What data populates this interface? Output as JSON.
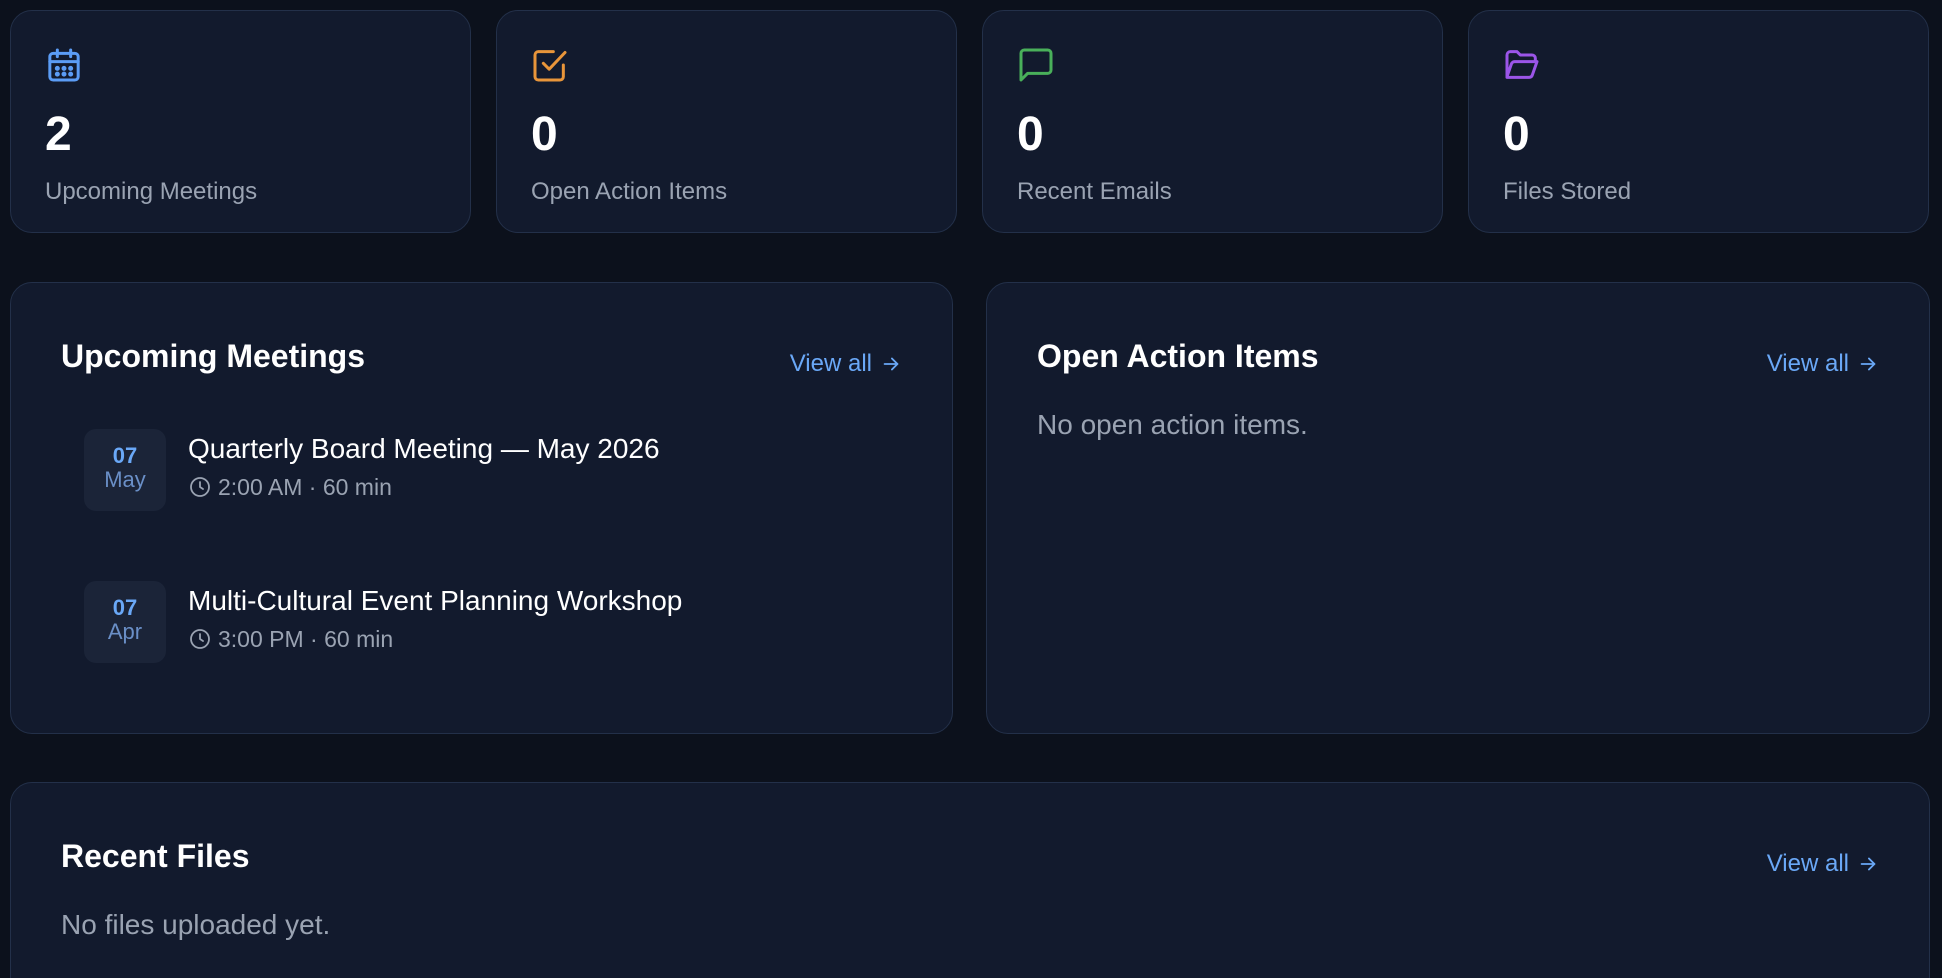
{
  "stats": [
    {
      "icon": "calendar-icon",
      "value": "2",
      "label": "Upcoming Meetings",
      "color": "#5b9cf5"
    },
    {
      "icon": "checkbox-icon",
      "value": "0",
      "label": "Open Action Items",
      "color": "#e8953a"
    },
    {
      "icon": "message-icon",
      "value": "0",
      "label": "Recent Emails",
      "color": "#49b05a"
    },
    {
      "icon": "folder-open-icon",
      "value": "0",
      "label": "Files Stored",
      "color": "#9b55e8"
    }
  ],
  "meetings_panel": {
    "title": "Upcoming Meetings",
    "view_all": "View all",
    "items": [
      {
        "day": "07",
        "month": "May",
        "title": "Quarterly Board Meeting — May 2026",
        "meta": "2:00 AM · 60 min"
      },
      {
        "day": "07",
        "month": "Apr",
        "title": "Multi-Cultural Event Planning Workshop",
        "meta": "3:00 PM · 60 min"
      }
    ]
  },
  "actions_panel": {
    "title": "Open Action Items",
    "view_all": "View all",
    "empty": "No open action items."
  },
  "files_panel": {
    "title": "Recent Files",
    "view_all": "View all",
    "empty": "No files uploaded yet."
  },
  "colors": {
    "background": "#0c111c",
    "card": "#121a2d",
    "border": "#233049",
    "accent": "#6aa8f7",
    "muted_text": "#9aa3b2"
  }
}
